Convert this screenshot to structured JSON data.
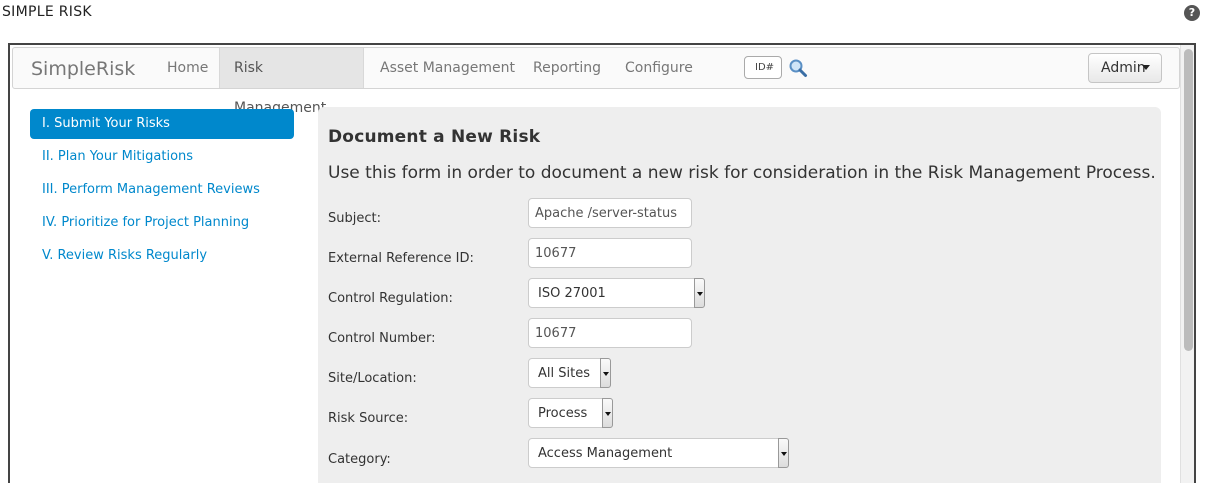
{
  "page": {
    "title": "SIMPLE RISK",
    "help_icon": "question-circle-icon",
    "help_glyph": "?"
  },
  "navbar": {
    "brand": "SimpleRisk",
    "items": [
      {
        "label": "Home",
        "active": false
      },
      {
        "label": "Risk Management",
        "active": true
      },
      {
        "label": "Asset Management",
        "active": false
      },
      {
        "label": "Reporting",
        "active": false
      },
      {
        "label": "Configure",
        "active": false
      }
    ],
    "id_search_placeholder": "ID#",
    "search_icon": "magnifier-icon",
    "user_menu_label": "Admin"
  },
  "sidebar": {
    "items": [
      {
        "label": "I. Submit Your Risks",
        "active": true
      },
      {
        "label": "II. Plan Your Mitigations",
        "active": false
      },
      {
        "label": "III. Perform Management Reviews",
        "active": false
      },
      {
        "label": "IV. Prioritize for Project Planning",
        "active": false
      },
      {
        "label": "V. Review Risks Regularly",
        "active": false
      }
    ]
  },
  "form": {
    "title": "Document a New Risk",
    "description": "Use this form in order to document a new risk for consideration in the Risk Management Process.",
    "fields": {
      "subject": {
        "label": "Subject:",
        "value": "Apache /server-status"
      },
      "external_reference_id": {
        "label": "External Reference ID:",
        "value": "10677"
      },
      "control_regulation": {
        "label": "Control Regulation:",
        "value": "ISO 27001"
      },
      "control_number": {
        "label": "Control Number:",
        "value": "10677"
      },
      "site_location": {
        "label": "Site/Location:",
        "value": "All Sites"
      },
      "risk_source": {
        "label": "Risk Source:",
        "value": "Process"
      },
      "category": {
        "label": "Category:",
        "value": "Access Management"
      }
    }
  },
  "colors": {
    "accent": "#0088cc",
    "panel_background": "#eeeeee",
    "navbar_background": "#fafafa"
  }
}
